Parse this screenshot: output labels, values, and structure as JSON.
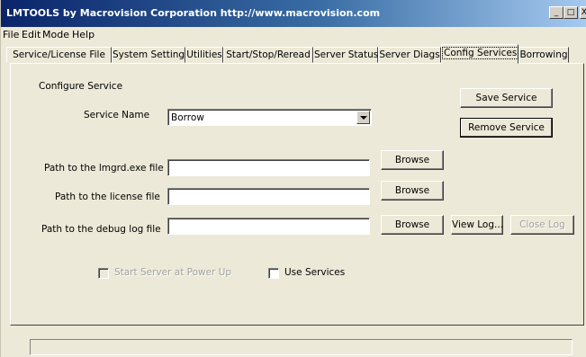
{
  "window": {
    "title": "LMTOOLS by Macrovision Corporation http://www.macrovision.com",
    "minimize_glyph": "_",
    "maximize_glyph": "□",
    "close_glyph": "X"
  },
  "menu": {
    "items": [
      "File",
      "Edit",
      "Mode",
      "Help"
    ]
  },
  "tabs": [
    {
      "label": "Service/License File",
      "active": false
    },
    {
      "label": "System Settings",
      "active": false
    },
    {
      "label": "Utilities",
      "active": false
    },
    {
      "label": "Start/Stop/Reread",
      "active": false
    },
    {
      "label": "Server Status",
      "active": false
    },
    {
      "label": "Server Diags",
      "active": false
    },
    {
      "label": "Config Services",
      "active": true
    },
    {
      "label": "Borrowing",
      "active": false
    }
  ],
  "config_services": {
    "section_title": "Configure Service",
    "service_name_label": "Service Name",
    "service_name_value": "Borrow",
    "lmgrd_path_label": "Path to the lmgrd.exe file",
    "lmgrd_path_value": "",
    "license_path_label": "Path to the license file",
    "license_path_value": "",
    "debug_log_label": "Path to the debug log file",
    "debug_log_value": "",
    "save_service_label": "Save Service",
    "remove_service_label": "Remove Service",
    "browse_label": "Browse",
    "view_log_label": "View Log...",
    "close_log_label": "Close Log",
    "start_at_powerup_label": "Start Server at Power Up",
    "start_at_powerup_checked": false,
    "start_at_powerup_enabled": false,
    "use_services_label": "Use Services",
    "use_services_checked": false
  },
  "status_bar": {
    "text": ""
  }
}
